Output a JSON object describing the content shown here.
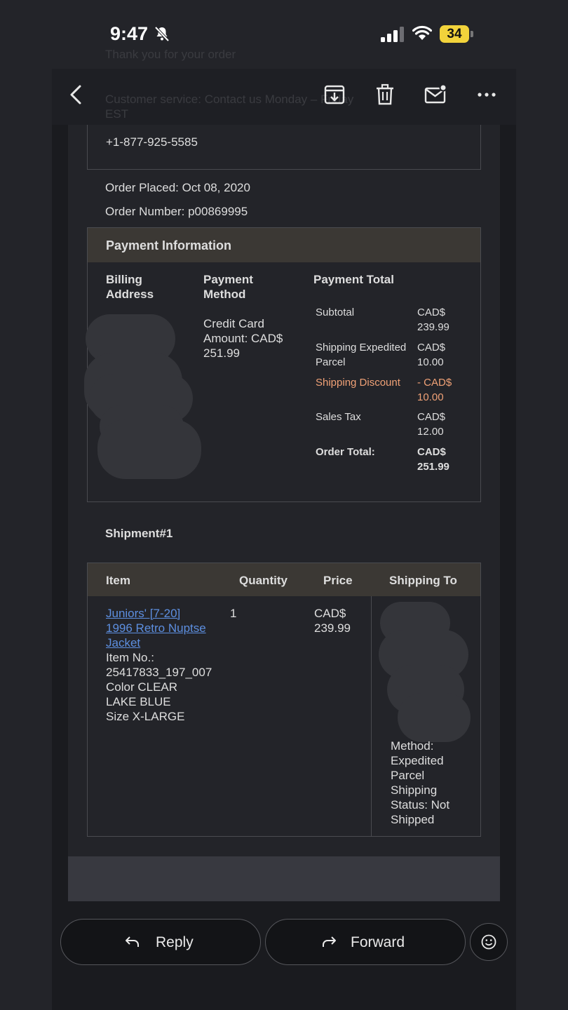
{
  "status": {
    "time": "9:47",
    "battery": "34"
  },
  "ghost": {
    "line1": "Thank you for your order",
    "line2": "Customer service: Contact us Monday – Friday",
    "line3": "EST"
  },
  "contact": {
    "phone": "+1-877-925-5585"
  },
  "order": {
    "placed": "Order Placed: Oct 08, 2020",
    "number": "Order Number: p00869995"
  },
  "payment": {
    "section_title": "Payment Information",
    "billing_header_1": "Billing",
    "billing_header_2": "Address",
    "method_header_1": "Payment",
    "method_header_2": "Method",
    "method_line1": "Credit Card",
    "method_line2": "Amount: CAD$",
    "method_line3": "251.99",
    "total_header": "Payment Total",
    "rows": [
      {
        "label1": "Subtotal",
        "label2": "",
        "cur": "CAD$",
        "val": "239.99"
      },
      {
        "label1": "Shipping Expedited",
        "label2": "Parcel",
        "cur": "CAD$",
        "val": "10.00"
      },
      {
        "label1": "Shipping Discount",
        "label2": "",
        "cur": "- CAD$",
        "val": "10.00"
      },
      {
        "label1": "Sales Tax",
        "label2": "",
        "cur": "CAD$",
        "val": "12.00"
      },
      {
        "label1": "Order Total:",
        "label2": "",
        "cur": "CAD$",
        "val": "251.99"
      }
    ]
  },
  "shipment": {
    "title": "Shipment#1",
    "headers": {
      "item": "Item",
      "quantity": "Quantity",
      "price": "Price",
      "ship_to": "Shipping To"
    },
    "item": {
      "link1": "Juniors' [7-20]",
      "link2": "1996 Retro Nuptse",
      "link3": "Jacket",
      "line1": "Item No.:",
      "line2": "25417833_197_007",
      "line3": "Color CLEAR",
      "line4": "LAKE BLUE",
      "line5": "Size X-LARGE"
    },
    "quantity": "1",
    "price_cur": "CAD$",
    "price_val": "239.99",
    "ship_lines": [
      "Method:",
      "Expedited",
      "Parcel",
      "Shipping",
      "Status: Not",
      "Shipped"
    ]
  },
  "actions": {
    "reply": "Reply",
    "forward": "Forward"
  }
}
